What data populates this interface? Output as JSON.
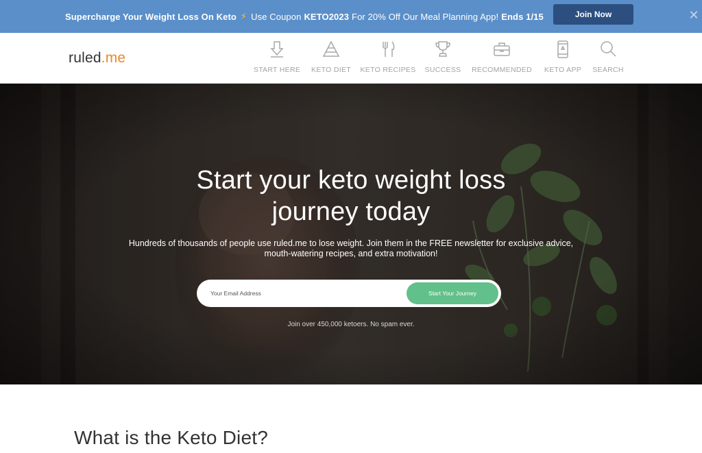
{
  "promo": {
    "text_part1": "Supercharge Your Weight Loss On Keto",
    "bolt": "⚡",
    "text_part2": "Use Coupon",
    "coupon_code": "KETO2023",
    "text_part3": "For 20% Off Our Meal Planning App!",
    "ends_text": "Ends 1/15",
    "button_label": "Join Now",
    "close_glyph": "✕"
  },
  "header": {
    "logo_main": "ruled",
    "logo_suffix": ".me",
    "nav": [
      {
        "label": "START HERE",
        "icon": "download-arrow-icon"
      },
      {
        "label": "KETO DIET",
        "icon": "pyramid-icon"
      },
      {
        "label": "KETO RECIPES",
        "icon": "fork-knife-icon"
      },
      {
        "label": "SUCCESS",
        "icon": "trophy-icon"
      },
      {
        "label": "RECOMMENDED",
        "icon": "briefcase-icon"
      },
      {
        "label": "KETO APP",
        "icon": "phone-icon"
      },
      {
        "label": "SEARCH",
        "icon": "search-icon"
      }
    ]
  },
  "hero": {
    "title_line1": "Start your keto weight loss",
    "title_line2": "journey today",
    "subtitle_line1": "Hundreds of thousands of people use ruled.me to lose weight. Join them in the FREE newsletter for exclusive advice,",
    "subtitle_line2": "mouth-watering recipes, and extra motivation!",
    "email_placeholder": "Your Email Address",
    "cta_label": "Start Your Journey",
    "note": "Join over 450,000 ketoers. No spam ever."
  },
  "section": {
    "title": "What is the Keto Diet?"
  },
  "colors": {
    "promo_bg": "#5b8fc9",
    "join_button": "#2c4f80",
    "logo_accent": "#e8892a",
    "cta_green": "#62c08a"
  }
}
